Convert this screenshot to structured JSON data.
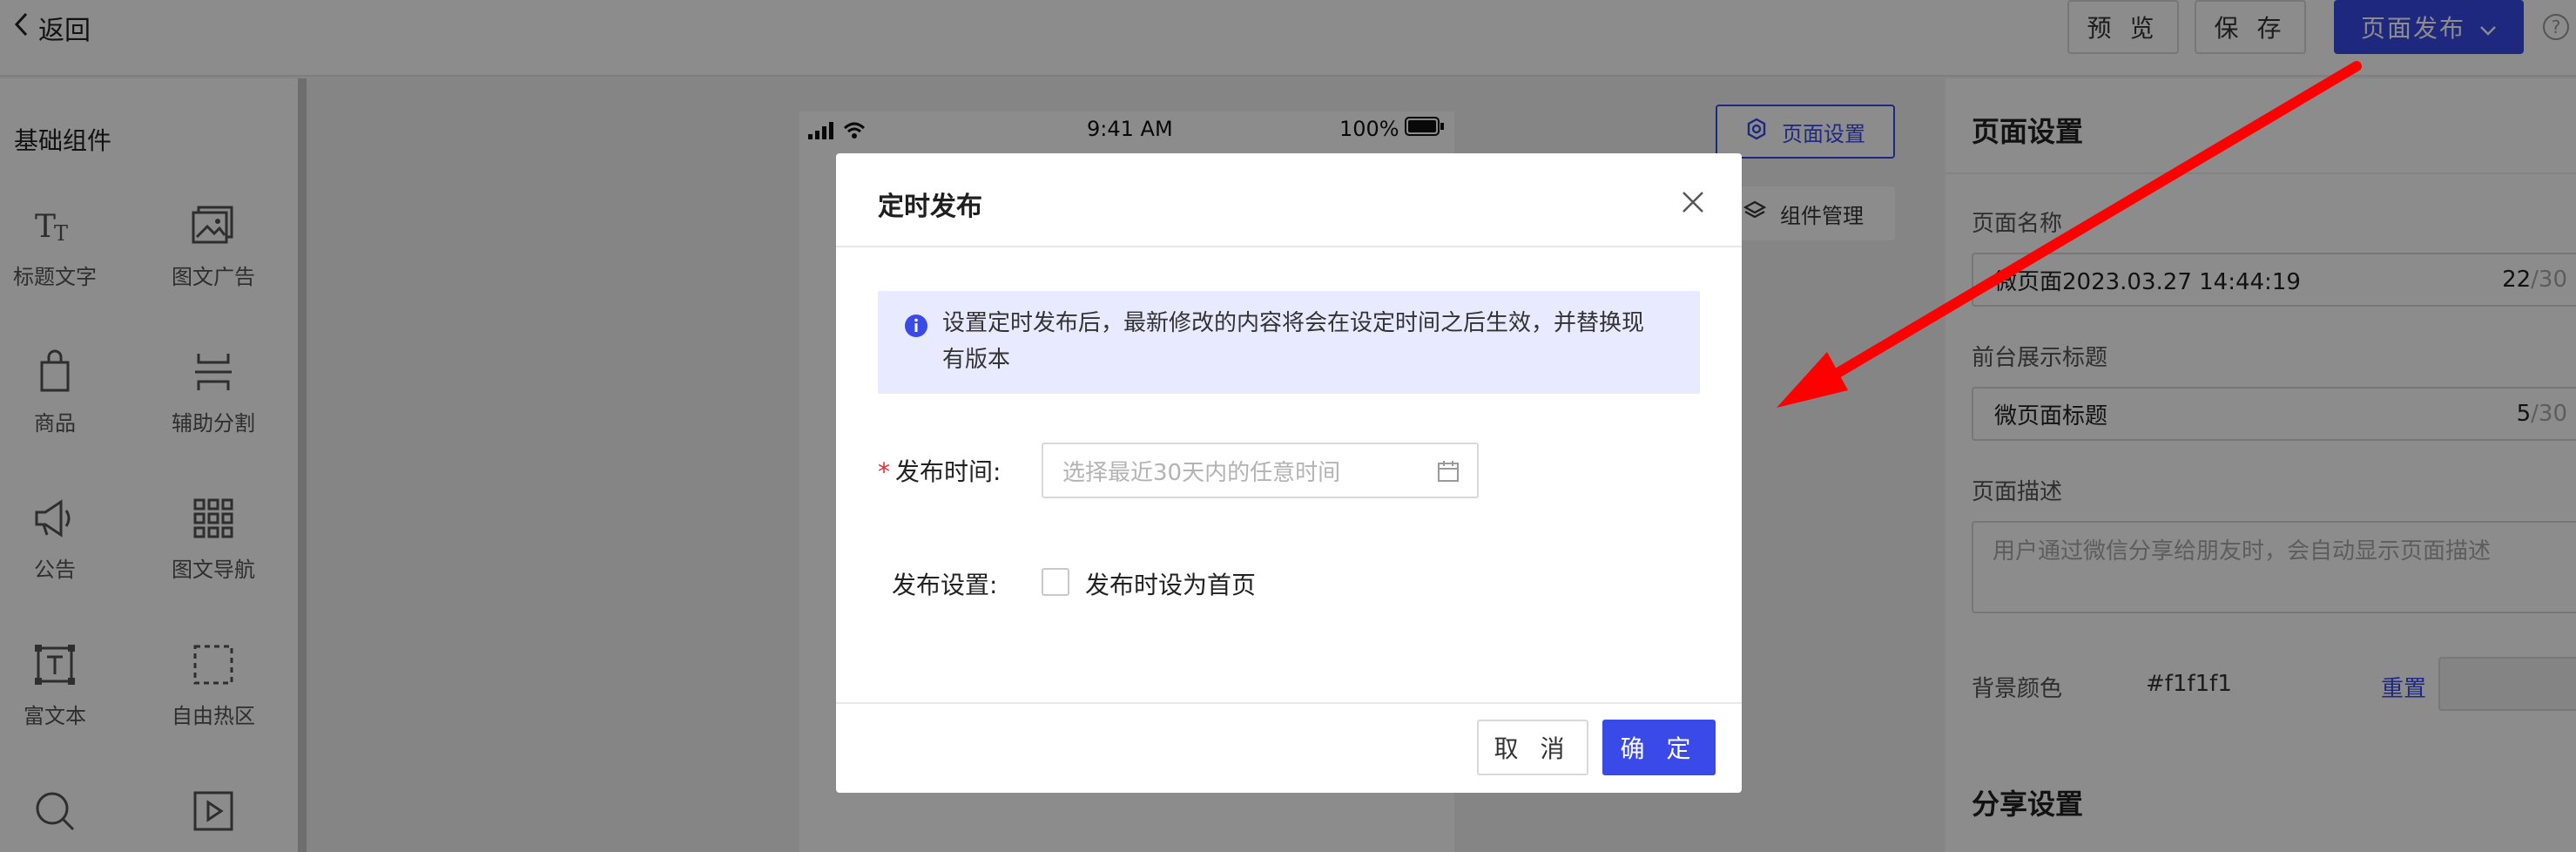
{
  "topbar": {
    "back_label": "返回",
    "preview_label": "预 览",
    "save_label": "保 存",
    "publish_label": "页面发布",
    "help_label": "?"
  },
  "sidebar": {
    "title": "基础组件",
    "items": [
      {
        "label": "标题文字",
        "icon": "title-text-icon"
      },
      {
        "label": "图文广告",
        "icon": "image-ad-icon"
      },
      {
        "label": "商品",
        "icon": "shopping-bag-icon"
      },
      {
        "label": "辅助分割",
        "icon": "divider-icon"
      },
      {
        "label": "公告",
        "icon": "megaphone-icon"
      },
      {
        "label": "图文导航",
        "icon": "grid-nav-icon"
      },
      {
        "label": "富文本",
        "icon": "rich-text-icon"
      },
      {
        "label": "自由热区",
        "icon": "hotzone-icon"
      },
      {
        "label": "",
        "icon": "search-icon"
      },
      {
        "label": "",
        "icon": "video-icon"
      }
    ]
  },
  "phone": {
    "time": "9:41 AM",
    "battery": "100%"
  },
  "tools": {
    "settings_label": "页面设置",
    "components_label": "组件管理"
  },
  "right_panel": {
    "title": "页面设置",
    "name_label": "页面名称",
    "name_value": "微页面2023.03.27 14:44:19",
    "name_count": "22",
    "name_max": "/30",
    "display_title_label": "前台展示标题",
    "display_title_value": "微页面标题",
    "display_title_count": "5",
    "display_title_max": "/30",
    "desc_label": "页面描述",
    "desc_placeholder": "用户通过微信分享给朋友时，会自动显示页面描述",
    "bg_label": "背景颜色",
    "bg_value": "#f1f1f1",
    "reset_label": "重置",
    "share_title": "分享设置"
  },
  "modal": {
    "title": "定时发布",
    "notice": "设置定时发布后，最新修改的内容将会在设定时间之后生效，并替换现有版本",
    "publish_time_label": "发布时间:",
    "publish_time_placeholder": "选择最近30天内的任意时间",
    "publish_setting_label": "发布设置:",
    "homepage_checkbox_label": "发布时设为首页",
    "cancel_label": "取 消",
    "ok_label": "确 定"
  },
  "colors": {
    "primary": "#3a4ae8",
    "annotation_arrow": "#ff0000",
    "notice_bg": "#e8ebff",
    "required": "#f5222d"
  }
}
